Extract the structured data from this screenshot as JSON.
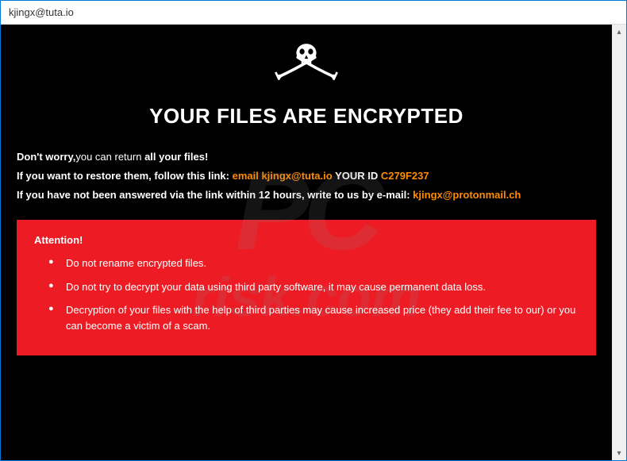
{
  "window": {
    "title": "kjingx@tuta.io"
  },
  "content": {
    "heading": "YOUR FILES ARE ENCRYPTED",
    "line1_prefix": "Don't worry,",
    "line1_mid": "you can return",
    "line1_suffix": " all your files!",
    "line2_prefix": "If you",
    "line2_mid": " want to restore them, follow this link: ",
    "line2_email_label": "email ",
    "line2_email": "kjingx@tuta.io",
    "line2_yourid_label": "  YOUR ID ",
    "line2_yourid": "C279F237",
    "line3_prefix": "If you",
    "line3_mid": " have not been answered ",
    "line3_mid2": "via the link within 12 hours, write to us by e-mail: ",
    "line3_email": "kjingx@protonmail.ch"
  },
  "attention": {
    "title": "Attention!",
    "items": [
      "Do not rename encrypted files.",
      "Do not try to decrypt your data using third party software, it may cause permanent data loss.",
      "Decryption of your files with the help of third parties may cause increased price (they add their fee to our) or you can become a victim of a scam."
    ]
  },
  "watermark": {
    "top": "PC",
    "bottom": "risk.com"
  }
}
